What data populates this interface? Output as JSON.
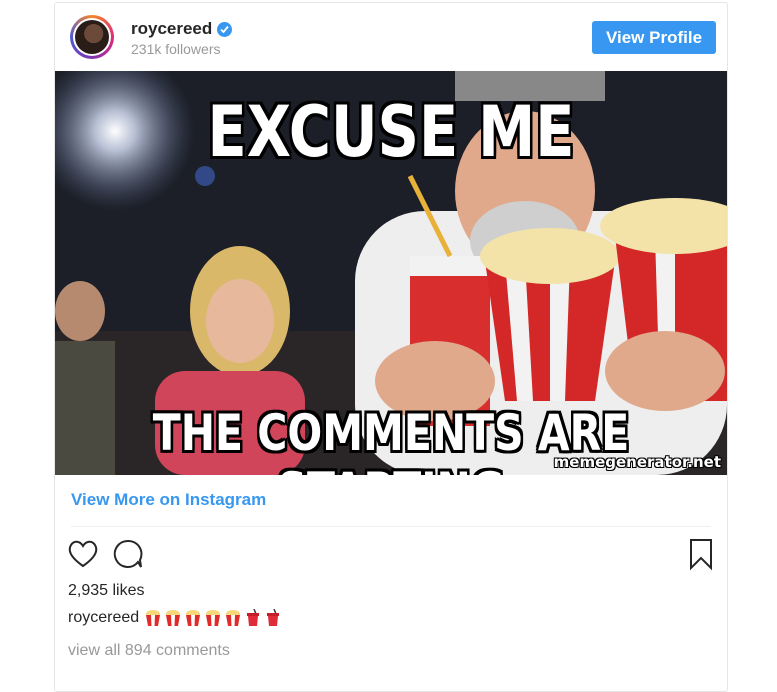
{
  "post": {
    "username": "roycereed",
    "followers": "231k followers",
    "view_profile_label": "View Profile",
    "meme_top_text": "EXCUSE ME",
    "meme_bottom_text": "THE COMMENTS ARE STARTING",
    "watermark": "memegenerator.net",
    "view_more_label": "View More on Instagram",
    "likes": "2,935 likes",
    "caption_user": "roycereed",
    "caption_emojis": [
      "popcorn-icon",
      "popcorn-icon",
      "popcorn-icon",
      "popcorn-icon",
      "popcorn-icon",
      "soda-cup-icon",
      "soda-cup-icon"
    ],
    "view_all_comments": "view all 894 comments"
  },
  "colors": {
    "accent": "#3897f0",
    "muted_text": "#999999",
    "border": "#e6e6e6"
  }
}
